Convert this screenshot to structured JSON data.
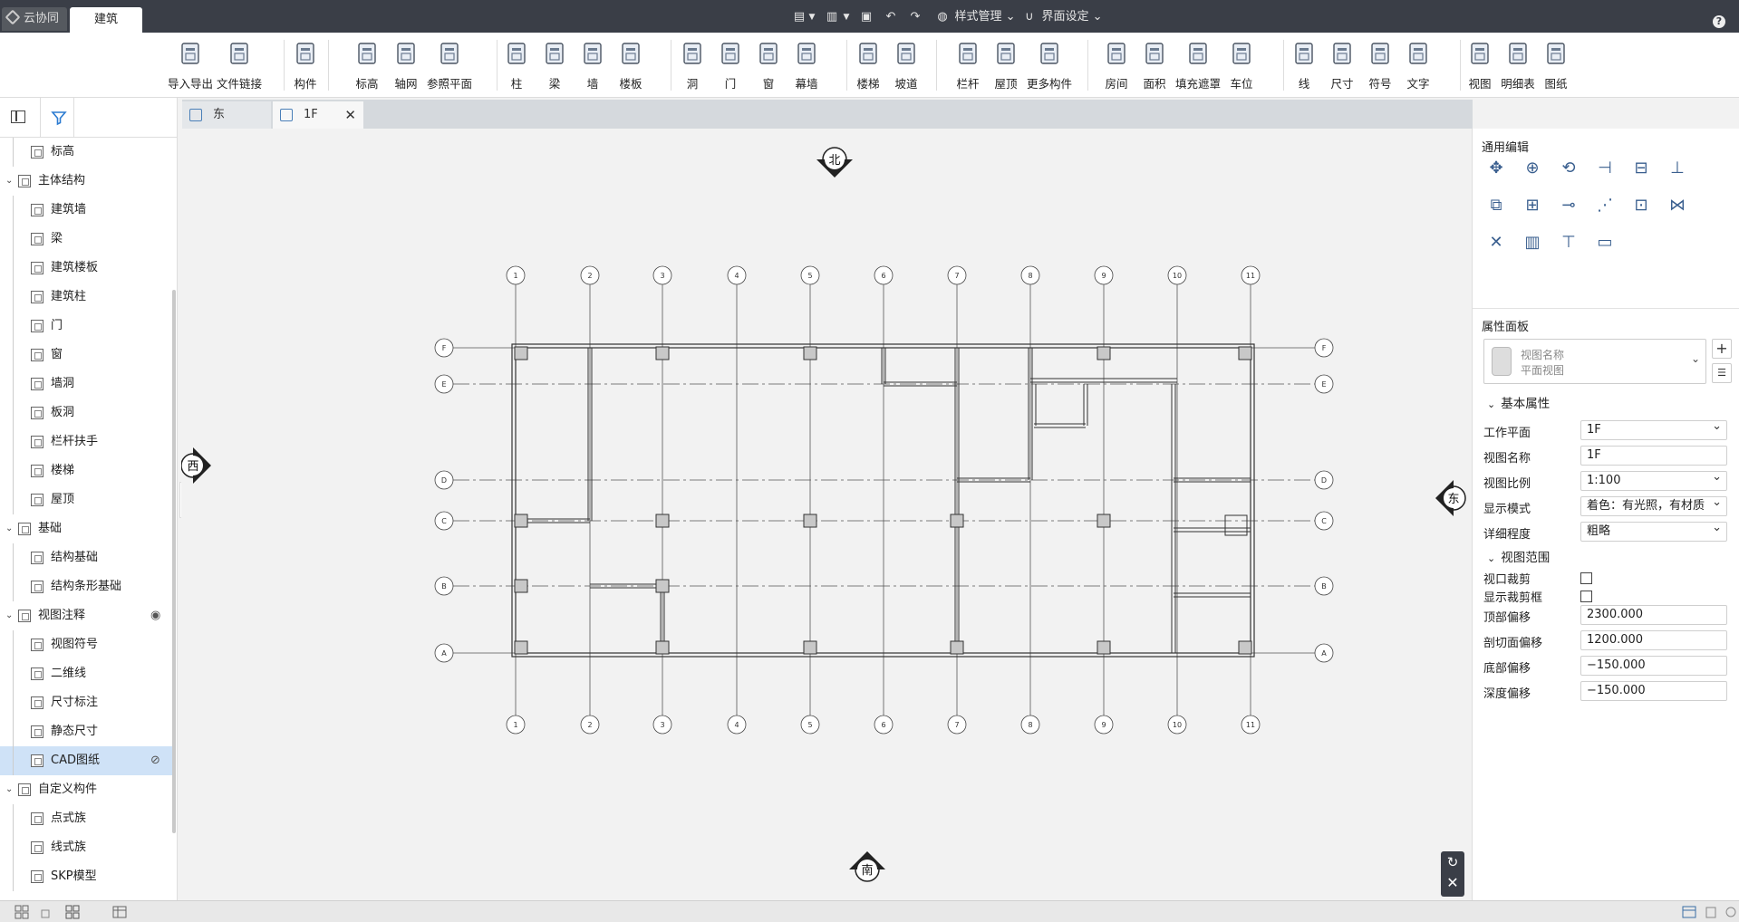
{
  "titlebar": {
    "tabs": [
      "云协同",
      "建筑"
    ],
    "style_menu": "样式管理",
    "ui_menu": "界面设定",
    "help": "?"
  },
  "ribbon": {
    "groups": [
      [
        "导入导出",
        "文件链接"
      ],
      [
        "构件"
      ],
      [
        "标高",
        "轴网",
        "参照平面"
      ],
      [
        "柱",
        "梁",
        "墙",
        "楼板"
      ],
      [
        "洞",
        "门",
        "窗",
        "幕墙"
      ],
      [
        "楼梯",
        "坡道"
      ],
      [
        "栏杆",
        "屋顶",
        "更多构件"
      ],
      [
        "房间",
        "面积",
        "填充遮罩",
        "车位"
      ],
      [
        "线",
        "尺寸",
        "符号",
        "文字"
      ],
      [
        "视图",
        "明细表",
        "图纸"
      ]
    ]
  },
  "tree": {
    "items": [
      {
        "label": "标高",
        "level": 2
      },
      {
        "label": "主体结构",
        "level": 1
      },
      {
        "label": "建筑墙",
        "level": 2
      },
      {
        "label": "梁",
        "level": 2
      },
      {
        "label": "建筑楼板",
        "level": 2
      },
      {
        "label": "建筑柱",
        "level": 2
      },
      {
        "label": "门",
        "level": 2
      },
      {
        "label": "窗",
        "level": 2
      },
      {
        "label": "墙洞",
        "level": 2
      },
      {
        "label": "板洞",
        "level": 2
      },
      {
        "label": "栏杆扶手",
        "level": 2
      },
      {
        "label": "楼梯",
        "level": 2
      },
      {
        "label": "屋顶",
        "level": 2
      },
      {
        "label": "基础",
        "level": 1
      },
      {
        "label": "结构基础",
        "level": 2
      },
      {
        "label": "结构条形基础",
        "level": 2
      },
      {
        "label": "视图注释",
        "level": 1
      },
      {
        "label": "视图符号",
        "level": 2
      },
      {
        "label": "二维线",
        "level": 2
      },
      {
        "label": "尺寸标注",
        "level": 2
      },
      {
        "label": "静态尺寸",
        "level": 2
      },
      {
        "label": "CAD图纸",
        "level": 2
      },
      {
        "label": "自定义构件",
        "level": 1
      },
      {
        "label": "点式族",
        "level": 2
      },
      {
        "label": "线式族",
        "level": 2
      },
      {
        "label": "SKP模型",
        "level": 2
      }
    ],
    "selected_index": 21
  },
  "doc_tabs": [
    "东",
    "1F"
  ],
  "plan": {
    "north": "北",
    "south": "南",
    "east": "东",
    "west": "西",
    "col_labels": [
      "1",
      "2",
      "3",
      "4",
      "5",
      "6",
      "7",
      "8",
      "9",
      "10",
      "11"
    ],
    "row_labels": [
      "F",
      "E",
      "D",
      "C",
      "B",
      "A"
    ]
  },
  "right": {
    "edit_title": "通用编辑",
    "prop_title": "属性面板",
    "view_type_name": "视图名称",
    "view_type_sub": "平面视图",
    "basic_section": "基本属性",
    "basic": [
      {
        "label": "工作平面",
        "value": "1F",
        "dropdown": true
      },
      {
        "label": "视图名称",
        "value": "1F",
        "dropdown": false
      },
      {
        "label": "视图比例",
        "value": "1:100",
        "dropdown": true
      },
      {
        "label": "显示模式",
        "value": "着色：有光照，有材质",
        "dropdown": true
      },
      {
        "label": "详细程度",
        "value": "粗略",
        "dropdown": true
      }
    ],
    "range_section": "视图范围",
    "checks": [
      {
        "label": "视口裁剪",
        "checked": false
      },
      {
        "label": "显示裁剪框",
        "checked": false
      }
    ],
    "offsets": [
      {
        "label": "顶部偏移",
        "value": "2300.000"
      },
      {
        "label": "剖切面偏移",
        "value": "1200.000"
      },
      {
        "label": "底部偏移",
        "value": "−150.000"
      },
      {
        "label": "深度偏移",
        "value": "−150.000"
      }
    ]
  }
}
